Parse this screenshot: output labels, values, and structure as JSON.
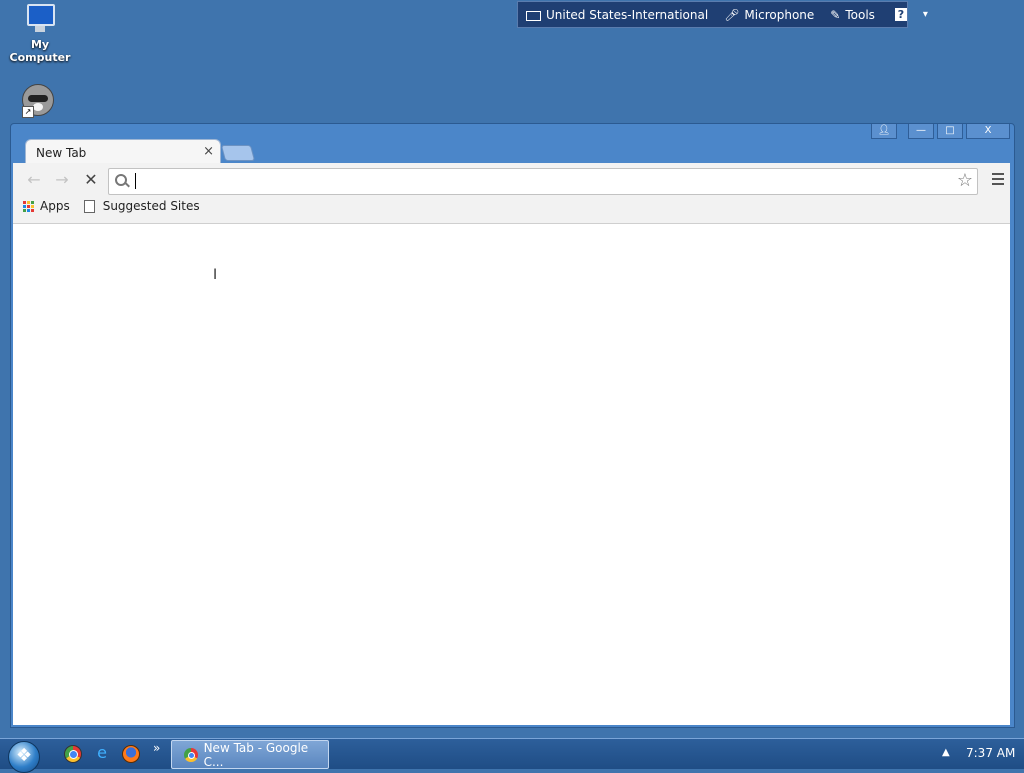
{
  "desktop": {
    "icons": [
      {
        "label": "My Computer",
        "icon": "computer-icon"
      },
      {
        "label": "",
        "icon": "raccoon-shortcut-icon"
      }
    ]
  },
  "language_bar": {
    "language": "United States-International",
    "microphone": "Microphone",
    "tools": "Tools",
    "help": "?"
  },
  "browser": {
    "tab": {
      "title": "New Tab",
      "close": "×"
    },
    "toolbar": {
      "back": "←",
      "forward": "→",
      "stop": "✕",
      "omnibox_value": "",
      "omnibox_placeholder": "",
      "star": "☆"
    },
    "bookmarks": [
      {
        "label": "Apps",
        "icon": "apps-grid-icon"
      },
      {
        "label": "Suggested Sites",
        "icon": "page-icon"
      }
    ],
    "window_controls": {
      "minimize": "—",
      "maximize": "□",
      "close": "X"
    }
  },
  "taskbar": {
    "pinned": [
      "chrome-icon",
      "internet-explorer-icon",
      "firefox-icon"
    ],
    "overflow": "»",
    "active_task": "New Tab - Google C...",
    "clock": "7:37 AM"
  },
  "colors": {
    "desktop": "#3f74ad",
    "window_frame": "#4b86c9",
    "taskbar": "#1f4d85"
  }
}
